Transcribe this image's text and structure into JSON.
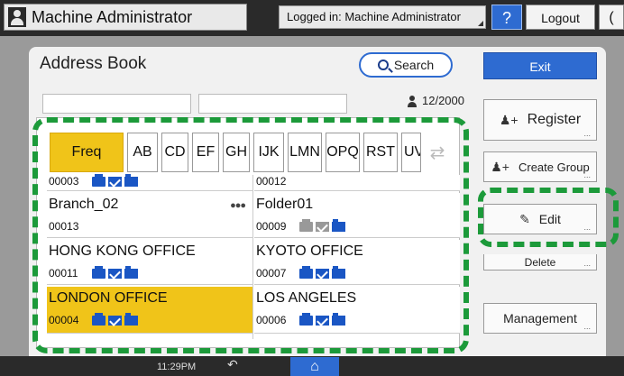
{
  "topbar": {
    "user_name": "Machine Administrator",
    "login_status": "Logged in: Machine Administrator",
    "help_label": "?",
    "logout_label": "Logout",
    "energy_label": "("
  },
  "panel": {
    "title": "Address Book",
    "search_label": "Search",
    "exit_label": "Exit",
    "count": "12/2000"
  },
  "tabs": [
    "Freq",
    "AB",
    "CD",
    "EF",
    "GH",
    "IJK",
    "LMN",
    "OPQ",
    "RST",
    "UV"
  ],
  "entries": {
    "top_left_num": "00003",
    "top_right_num": "00012",
    "e1_name": "Branch_02",
    "e1_num": "00013",
    "e2_name": "Folder01",
    "e2_num": "00009",
    "e3_name": "HONG KONG OFFICE",
    "e3_num": "00011",
    "e4_name": "KYOTO OFFICE",
    "e4_num": "00007",
    "e5_name": "LONDON OFFICE",
    "e5_num": "00004",
    "e6_name": "LOS ANGELES",
    "e6_num": "00006"
  },
  "right_buttons": {
    "register": "Register",
    "create_group": "Create Group",
    "edit": "Edit",
    "delete": "Delete",
    "management": "Management"
  },
  "bottom": {
    "time": "11:29PM"
  }
}
